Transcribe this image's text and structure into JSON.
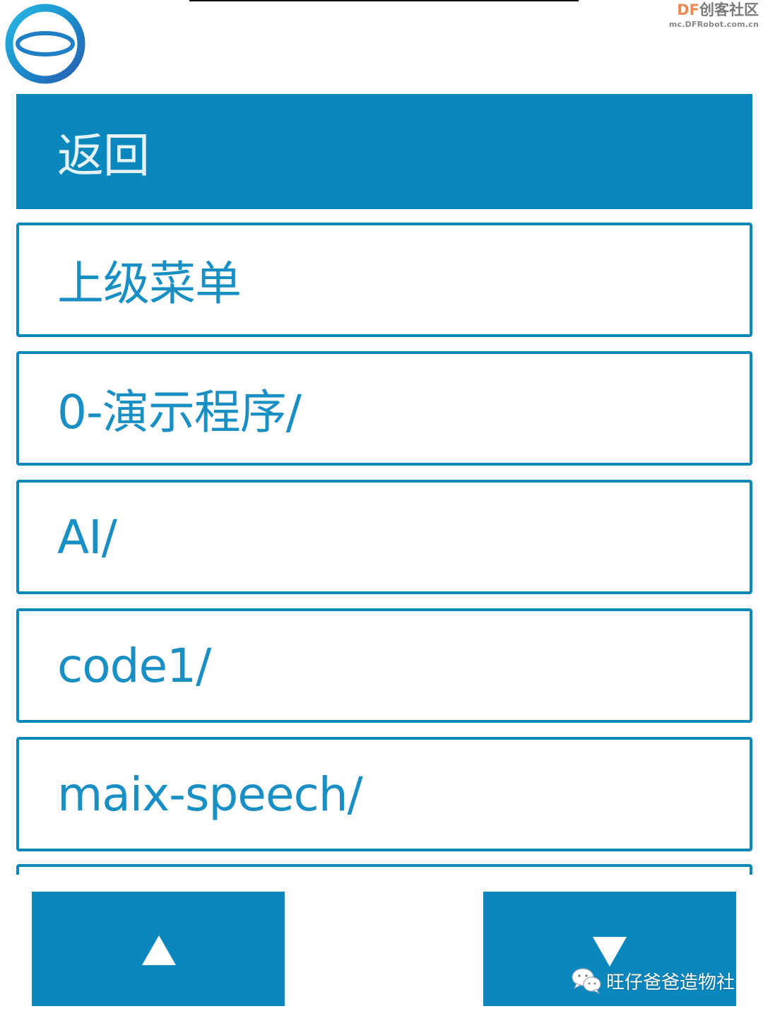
{
  "watermark_top": {
    "brand_prefix": "DF",
    "brand_suffix": "创客社区",
    "url": "mc.DFRobot.com.cn"
  },
  "menu": {
    "items": [
      {
        "label": "返回",
        "selected": true
      },
      {
        "label": "上级菜单",
        "selected": false
      },
      {
        "label": "0-演示程序/",
        "selected": false
      },
      {
        "label": "AI/",
        "selected": false
      },
      {
        "label": "code1/",
        "selected": false
      },
      {
        "label": "maix-speech/",
        "selected": false
      },
      {
        "label": "",
        "selected": false
      }
    ]
  },
  "nav": {
    "up_icon": "triangle-up-icon",
    "down_icon": "triangle-down-icon"
  },
  "watermark_bottom": {
    "icon": "wechat-icon",
    "text": "旺仔爸爸造物社"
  },
  "colors": {
    "accent": "#0a87bd",
    "text_selected": "#e4f3fa",
    "text_item": "#1a8fc3",
    "watermark_df": "#ea8b55"
  }
}
